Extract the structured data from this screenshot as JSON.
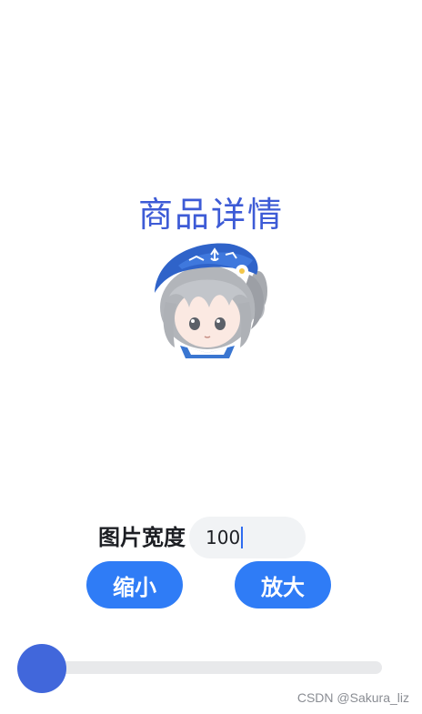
{
  "page": {
    "title": "商品详情"
  },
  "image": {
    "alt_icon": "avatar-girl-sailor-hat"
  },
  "controls": {
    "width_label": "图片宽度",
    "width_value": "100",
    "shrink_label": "缩小",
    "enlarge_label": "放大"
  },
  "slider": {
    "value_fraction": 0.0
  },
  "watermark": "CSDN @Sakura_liz",
  "colors": {
    "title": "#3d5bd6",
    "button": "#2f7cf6",
    "slider_thumb": "#4167db",
    "slider_track": "#e8e9eb"
  }
}
